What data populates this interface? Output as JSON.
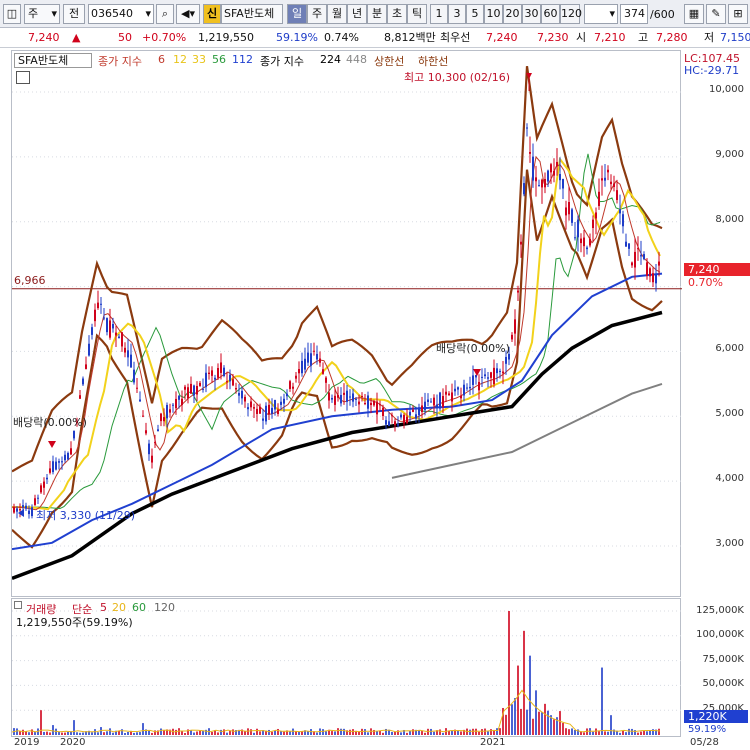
{
  "toolbar": {
    "market": "주",
    "period_btn": "전",
    "code": "036540",
    "stock_name": "SFA반도체",
    "new_badge": "신",
    "timeframes": [
      "일",
      "주",
      "월",
      "년",
      "분",
      "초",
      "틱"
    ],
    "intervals": [
      "1",
      "3",
      "5",
      "10",
      "20",
      "30",
      "60",
      "120"
    ],
    "count": "374",
    "count_total": "/600"
  },
  "info": {
    "price": "7,240",
    "change_arrow": "▲",
    "change": "50",
    "change_pct": "+0.70%",
    "volume": "1,219,550",
    "turnover_ratio": "59.19%",
    "ratio2": "0.74%",
    "amount": "8,812백만",
    "pref_label": "최우선",
    "bid": "7,240",
    "ask": "7,230",
    "open_label": "시",
    "open": "7,210",
    "high_label": "고",
    "high": "7,280",
    "low_label": "저",
    "low": "7,150"
  },
  "legend": {
    "name": "SFA반도체",
    "ma_label": "종가 지수",
    "ma": [
      "6",
      "12",
      "33",
      "56",
      "112"
    ],
    "ma2_label": "종가 지수",
    "ma2": [
      "224",
      "448"
    ],
    "band_upper": "상한선",
    "band_lower": "하한선"
  },
  "annotations": {
    "high": "최고 10,300 (02/16)",
    "low": "최저 3,330 (11/29)",
    "div1": "배당락(0.00%)",
    "div2": "배당락(0.00%)",
    "hline": "6,966",
    "lc": "LC:107.45",
    "hc": "HC:-29.71",
    "current_price": "7,240",
    "current_pct": "0.70%"
  },
  "volume_legend": {
    "title": "거래량",
    "ma_label": "단순",
    "ma": [
      "5",
      "20",
      "60",
      "120"
    ],
    "current": "1,219,550주(59.19%)",
    "badge_value": "1,220K",
    "badge_pct": "59.19%"
  },
  "y_axis": [
    "10,000",
    "9,000",
    "8,000",
    "7,000",
    "6,000",
    "5,000",
    "4,000",
    "3,000"
  ],
  "vol_axis": [
    "125,000K",
    "100,000K",
    "75,000K",
    "50,000K",
    "25,000K"
  ],
  "x_axis": [
    "2019",
    "2020",
    "2021",
    "05/28"
  ],
  "colors": {
    "up": "#d0021b",
    "down": "#1e3cc8",
    "band": "#8b3a0f",
    "ma6": "#c0392b",
    "ma12": "#f2d21b",
    "ma33": "#d79a1e",
    "ma56": "#2a9a3c",
    "ma112": "#2040d0",
    "ma224": "#000000",
    "ma448": "#808080"
  },
  "chart_data": {
    "type": "line",
    "price_range": [
      2500,
      10500
    ],
    "volume_range": [
      0,
      130000
    ],
    "series": [
      {
        "name": "112",
        "values": [
          [
            0,
            2950
          ],
          [
            40,
            3050
          ],
          [
            80,
            3400
          ],
          [
            120,
            3650
          ],
          [
            160,
            3950
          ],
          [
            200,
            4250
          ],
          [
            260,
            4800
          ],
          [
            320,
            5000
          ],
          [
            380,
            5100
          ],
          [
            440,
            5150
          ],
          [
            480,
            5250
          ],
          [
            510,
            5550
          ],
          [
            540,
            6250
          ],
          [
            580,
            6850
          ],
          [
            620,
            7150
          ],
          [
            650,
            7200
          ]
        ]
      },
      {
        "name": "224",
        "values": [
          [
            0,
            2500
          ],
          [
            60,
            2850
          ],
          [
            120,
            3500
          ],
          [
            160,
            3800
          ],
          [
            220,
            4150
          ],
          [
            280,
            4500
          ],
          [
            340,
            4750
          ],
          [
            400,
            4900
          ],
          [
            460,
            5050
          ],
          [
            500,
            5150
          ],
          [
            530,
            5650
          ],
          [
            560,
            6050
          ],
          [
            600,
            6400
          ],
          [
            650,
            6600
          ]
        ]
      },
      {
        "name": "448",
        "values": [
          [
            380,
            4050
          ],
          [
            440,
            4250
          ],
          [
            500,
            4450
          ],
          [
            540,
            4750
          ],
          [
            580,
            5050
          ],
          [
            620,
            5350
          ],
          [
            650,
            5500
          ]
        ]
      }
    ]
  }
}
